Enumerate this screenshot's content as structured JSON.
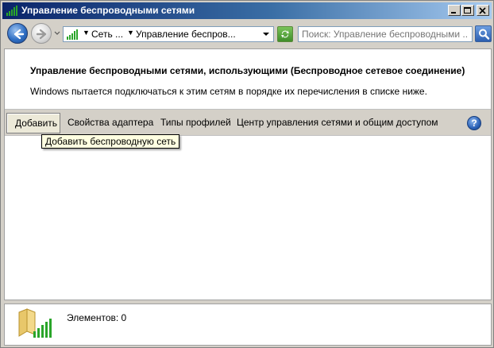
{
  "window": {
    "title": "Управление беспроводными сетями",
    "controls": [
      "minimize",
      "maximize",
      "close"
    ]
  },
  "address_bar": {
    "breadcrumbs": [
      "Сеть ...",
      "Управление беспров..."
    ],
    "search_placeholder": "Поиск: Управление беспроводными ..."
  },
  "content": {
    "heading": "Управление беспроводными сетями, использующими (Беспроводное сетевое соединение)",
    "description": "Windows пытается подключаться к этим сетям в порядке их перечисления в списке ниже."
  },
  "toolbar": {
    "add_label": "Добавить",
    "adapter_props_label": "Свойства адаптера",
    "profile_types_label": "Типы профилей",
    "network_center_label": "Центр управления сетями и общим доступом",
    "help_label": "?"
  },
  "tooltip": {
    "text": "Добавить беспроводную сеть"
  },
  "details": {
    "items_count": "Элементов: 0"
  },
  "colors": {
    "titlebar_start": "#0a246a",
    "titlebar_end": "#a6caf0",
    "chrome": "#d4d0c8",
    "tooltip_bg": "#ffffe1"
  }
}
